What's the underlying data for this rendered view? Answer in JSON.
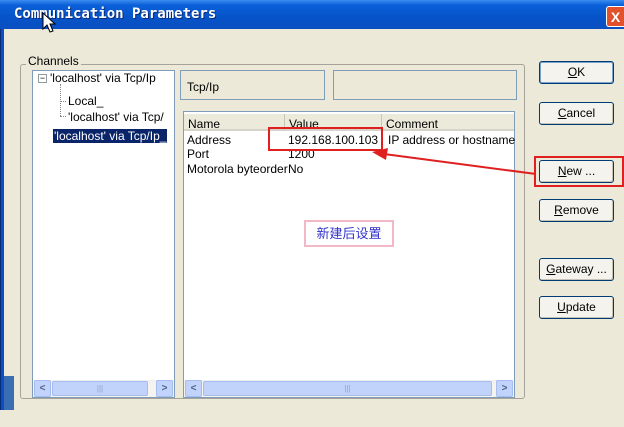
{
  "window": {
    "title": "Communication Parameters",
    "close_glyph": "X"
  },
  "channels": {
    "group_label": "Channels",
    "tree": {
      "expander": "−",
      "root": "'localhost' via Tcp/Ip",
      "child1": "Local_",
      "child2": "'localhost' via Tcp/",
      "selected": "'localhost' via Tcp/Ip_"
    },
    "protocol_field": "Tcp/Ip",
    "name_field": "",
    "columns": [
      "Name",
      "Value",
      "Comment"
    ],
    "rows": [
      {
        "name": "Address",
        "value": "192.168.100.103",
        "comment": "IP address or hostname"
      },
      {
        "name": "Port",
        "value": "1200",
        "comment": ""
      },
      {
        "name": "Motorola byteorder",
        "value": "No",
        "comment": ""
      }
    ],
    "scroll": {
      "left_arrow": "<",
      "right_arrow": ">",
      "thumb": "|||"
    }
  },
  "buttons": {
    "ok": {
      "pre": "",
      "accel": "O",
      "post": "K"
    },
    "cancel": {
      "pre": "",
      "accel": "C",
      "post": "ancel"
    },
    "new": {
      "pre": "",
      "accel": "N",
      "post": "ew ..."
    },
    "remove": {
      "pre": "",
      "accel": "R",
      "post": "emove"
    },
    "gateway": {
      "pre": "",
      "accel": "G",
      "post": "ateway ..."
    },
    "update": {
      "pre": "",
      "accel": "U",
      "post": "pdate"
    }
  },
  "annotation": {
    "note": "新建后设置",
    "highlight_color": "#e02020"
  },
  "colors": {
    "titlebar": "#0653c9",
    "selection": "#0a246a",
    "dialog_bg": "#ece9d8"
  }
}
